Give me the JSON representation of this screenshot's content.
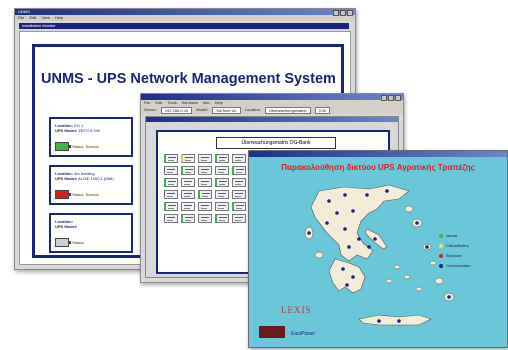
{
  "window1": {
    "title": "UNMS",
    "menu": [
      "File",
      "Edit",
      "View",
      "Help"
    ],
    "subwindow_title": "Installation Monitor",
    "heading": "UNMS - UPS Network Management System",
    "cards": [
      {
        "location_label": "Location:",
        "location": "EG 1",
        "model_label": "UPS Model:",
        "model": "ZEFO 6 000",
        "status": "Status: Normal",
        "status_color": "#39b54a"
      },
      {
        "location_label": "Location:",
        "location": "4th building",
        "model_label": "UPS Model:",
        "model": "ALISE 1000 1 (IBM)",
        "status": "Status: Normal",
        "status_color": "#d02020"
      },
      {
        "location_label": "Location:",
        "location": "",
        "model_label": "UPS Model:",
        "model": "",
        "status": "Status:",
        "status_color": "#c0c0c0"
      }
    ]
  },
  "window2": {
    "menu": [
      "File",
      "Edit",
      "Tools",
      "Windows",
      "Info",
      "Help"
    ],
    "toolbar": {
      "server_label": "Server:",
      "server_value": "192.168.0.10",
      "model_label": "Model:",
      "model_value": "SinTech UL",
      "location_label": "Location:",
      "location_value": "Überwachungsmatrix",
      "btn": "0:30"
    },
    "panel_title": "Überwachungsmatrix DG-Bank"
  },
  "window3": {
    "title": "Παρακολούθηση δικτύου UPS Αγροτικής Τραπέζης",
    "brand": "LEXIS",
    "footer": "EastPower",
    "legend": [
      {
        "label": "Normal",
        "color": "#39b54a"
      },
      {
        "label": "Critical/Battery",
        "color": "#f2e34c"
      },
      {
        "label": "Shutdown",
        "color": "#d02020"
      },
      {
        "label": "Communication",
        "color": "#1a237e"
      }
    ]
  }
}
